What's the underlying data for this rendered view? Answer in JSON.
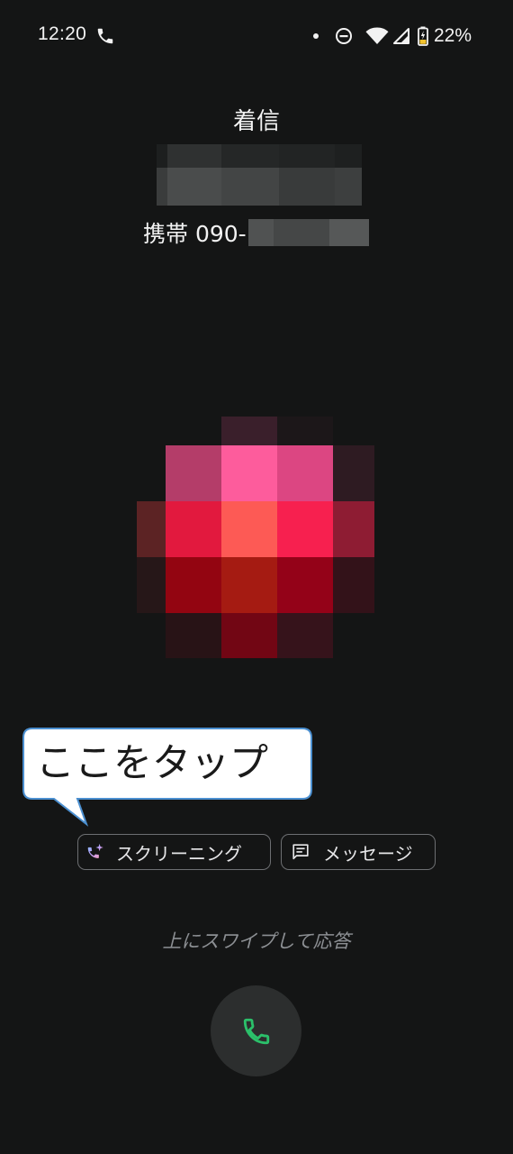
{
  "status_bar": {
    "time": "12:20",
    "battery_percent": "22%",
    "icons": [
      "phone-icon",
      "dot-icon",
      "do-not-disturb-icon",
      "wifi-icon",
      "cellular-signal-icon",
      "battery-charging-icon"
    ]
  },
  "call": {
    "label": "着信",
    "number_prefix": "携帯 090-"
  },
  "callout": {
    "text": "ここをタップ"
  },
  "actions": {
    "screening_label": "スクリーニング",
    "screening_icon": "call-screen-sparkle-icon",
    "message_label": "メッセージ",
    "message_icon": "message-icon"
  },
  "swipe_hint": "上にスワイプして応答",
  "answer": {
    "icon": "phone-icon"
  },
  "colors": {
    "background": "#141515",
    "answer_button": "#2c2e2e",
    "answer_icon": "#2bc06a",
    "chip_border": "#6d6f72",
    "callout_fill": "#ffffff",
    "callout_border": "#4b8fd0"
  }
}
